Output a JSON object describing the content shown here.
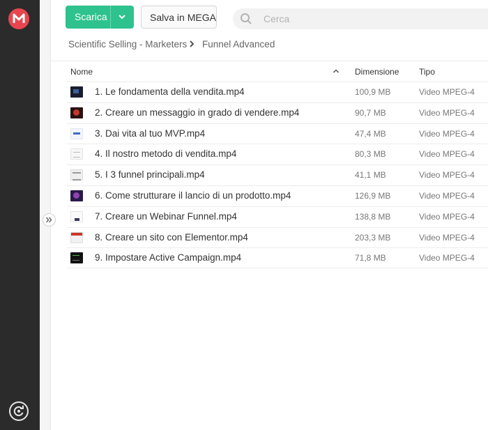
{
  "toolbar": {
    "download_label": "Scarica",
    "save_label": "Salva in MEGA",
    "search_placeholder": "Cerca",
    "accent_color": "#2ec28e"
  },
  "brand": {
    "logo_letter": "M",
    "logo_color": "#e9454f"
  },
  "breadcrumb": {
    "items": [
      "Scientific Selling - Marketers",
      "Funnel Advanced"
    ]
  },
  "columns": {
    "name": "Nome",
    "size": "Dimensione",
    "type": "Tipo"
  },
  "files": [
    {
      "name": "1. Le fondamenta della vendita.mp4",
      "size": "100,9 MB",
      "type": "Video MPEG-4",
      "thumb": "t-dark"
    },
    {
      "name": "2. Creare un messaggio in grado di vendere.mp4",
      "size": "90,7 MB",
      "type": "Video MPEG-4",
      "thumb": "t-red"
    },
    {
      "name": "3. Dai vita al tuo MVP.mp4",
      "size": "47,4 MB",
      "type": "Video MPEG-4",
      "thumb": "t-light-blue"
    },
    {
      "name": "4. Il nostro metodo di vendita.mp4",
      "size": "80,3 MB",
      "type": "Video MPEG-4",
      "thumb": "t-doc"
    },
    {
      "name": "5. I 3 funnel principali.mp4",
      "size": "41,1 MB",
      "type": "Video MPEG-4",
      "thumb": "t-lines"
    },
    {
      "name": "6. Come strutturare il lancio di un prodotto.mp4",
      "size": "126,9 MB",
      "type": "Video MPEG-4",
      "thumb": "t-purple"
    },
    {
      "name": "7. Creare un Webinar Funnel.mp4",
      "size": "138,8 MB",
      "type": "Video MPEG-4",
      "thumb": "t-white"
    },
    {
      "name": "8. Creare un sito con Elementor.mp4",
      "size": "203,3 MB",
      "type": "Video MPEG-4",
      "thumb": "t-site"
    },
    {
      "name": "9. Impostare Active Campaign.mp4",
      "size": "71,8 MB",
      "type": "Video MPEG-4",
      "thumb": "t-black"
    }
  ]
}
